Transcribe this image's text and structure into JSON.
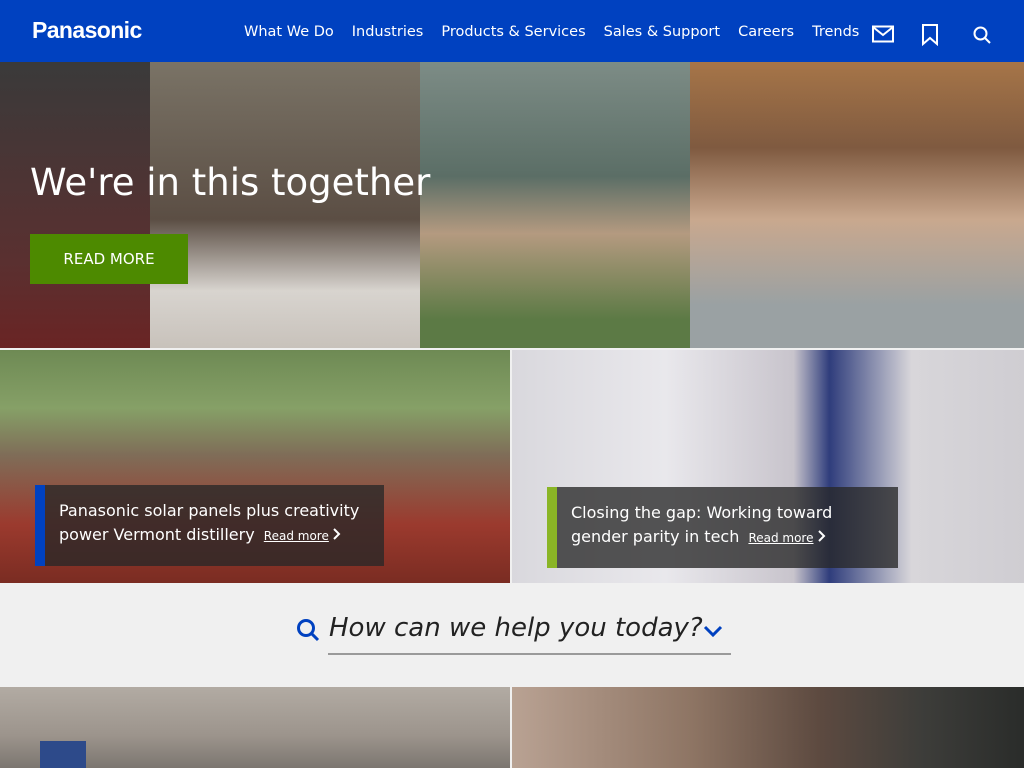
{
  "brand": {
    "name": "Panasonic",
    "primary": "#0041c0",
    "accent_green": "#4d8a00",
    "accent_blue": "#0041c0",
    "accent_lime": "#8ab526"
  },
  "nav": {
    "items": [
      "What We Do",
      "Industries",
      "Products & Services",
      "Sales & Support",
      "Careers",
      "Trends"
    ],
    "icons": [
      "mail-icon",
      "bookmark-icon",
      "search-icon"
    ]
  },
  "hero": {
    "title": "We're in this together",
    "button_label": "READ MORE"
  },
  "cards": [
    {
      "text": "Panasonic solar panels plus creativity power Vermont distillery",
      "link": "Read more"
    },
    {
      "text": "Closing the gap: Working toward gender parity in tech",
      "link": "Read more"
    }
  ],
  "help": {
    "prompt": "How can we help you today?"
  }
}
